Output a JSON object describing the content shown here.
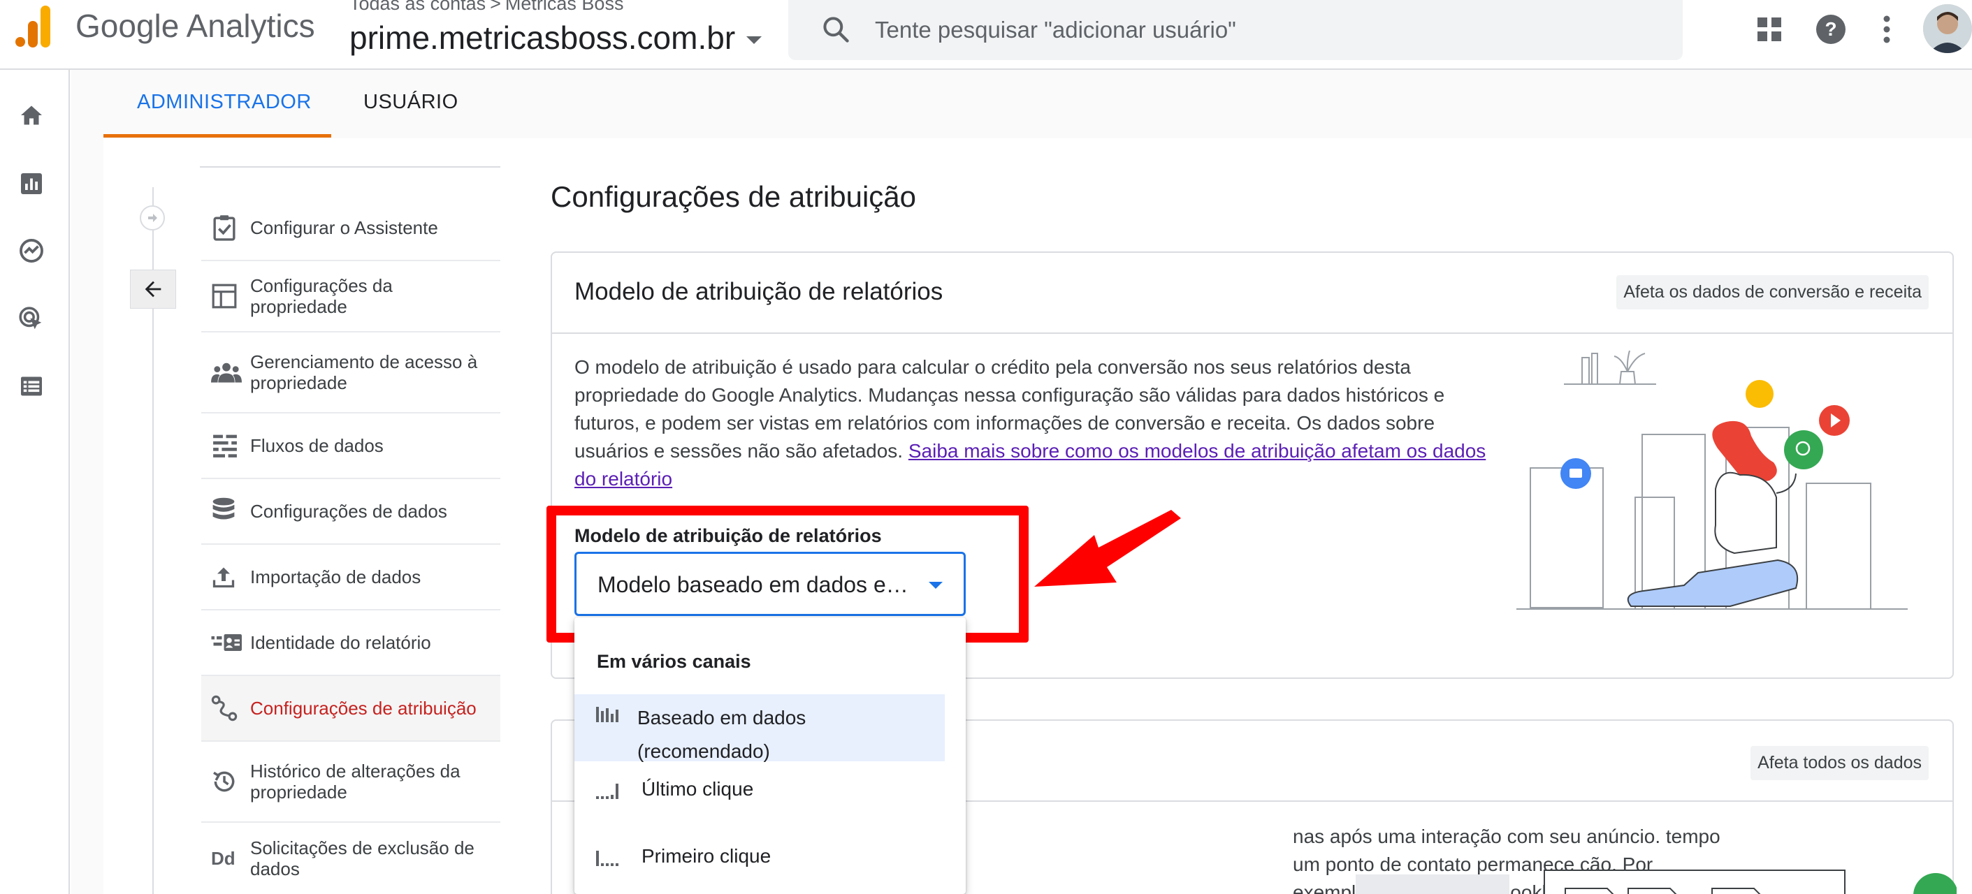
{
  "topbar": {
    "product_name": "Google Analytics",
    "breadcrumb": [
      "Todas as contas",
      "Métricas Boss"
    ],
    "breadcrumb_separator": ">",
    "property_name": "prime.metricasboss.com.br",
    "search_placeholder": "Tente pesquisar \"adicionar usuário\"",
    "icons": [
      "apps-grid-icon",
      "help-icon",
      "more-vert-icon"
    ]
  },
  "left_rail": {
    "icons": [
      "home-icon",
      "reports-icon",
      "explore-icon",
      "advertising-icon",
      "configure-icon"
    ]
  },
  "tabs": {
    "admin": "ADMINISTRADOR",
    "user": "USUÁRIO",
    "active": "admin",
    "accent_color": "#e8710a"
  },
  "sidebar": {
    "items": [
      {
        "label": "Configurar o Assistente",
        "icon": "checklist-icon"
      },
      {
        "label": "Configurações da propriedade",
        "icon": "property-layout-icon"
      },
      {
        "label": "Gerenciamento de acesso à propriedade",
        "icon": "people-icon"
      },
      {
        "label": "Fluxos de dados",
        "icon": "data-streams-icon"
      },
      {
        "label": "Configurações de dados",
        "icon": "database-icon"
      },
      {
        "label": "Importação de dados",
        "icon": "upload-icon"
      },
      {
        "label": "Identidade do relatório",
        "icon": "reporting-identity-icon"
      },
      {
        "label": "Configurações de atribuição",
        "icon": "attribution-icon",
        "active": true
      },
      {
        "label": "Histórico de alterações da propriedade",
        "icon": "history-icon"
      },
      {
        "label": "Solicitações de exclusão de dados",
        "icon": "data-deletion-icon"
      }
    ]
  },
  "page": {
    "title": "Configurações de atribuição"
  },
  "card1": {
    "title": "Modelo de atribuição de relatórios",
    "chip": "Afeta os dados de conversão e receita",
    "description": "O modelo de atribuição é usado para calcular o crédito pela conversão nos seus relatórios desta propriedade do Google Analytics. Mudanças nessa configuração são válidas para dados históricos e futuros, e podem ser vistas em relatórios com informações de conversão e receita. Os dados sobre usuários e sessões não são afetados. ",
    "learn_more": "Saiba mais sobre como os modelos de atribuição afetam os dados do relatório",
    "field_label": "Modelo de atribuição de relatórios",
    "selected_value": "Modelo baseado em dados em vários canais"
  },
  "dropdown": {
    "group_label": "Em vários canais",
    "options": [
      {
        "label": "Baseado em dados (recomendado)",
        "icon": "data-driven-bars-icon",
        "selected": true
      },
      {
        "label": "Último clique",
        "icon": "last-click-bars-icon"
      },
      {
        "label": "Primeiro clique",
        "icon": "first-click-bars-icon"
      }
    ]
  },
  "card2": {
    "chip": "Afeta todos os dados",
    "description": "nas após uma interação com seu anúncio. tempo um ponto de contato permanece ção. Por exemplo, uma janela de lookback"
  },
  "colors": {
    "highlight": "#ff0000",
    "link": "#5b1fb5",
    "primary": "#1a73e8",
    "active_nav": "#c5221f"
  }
}
